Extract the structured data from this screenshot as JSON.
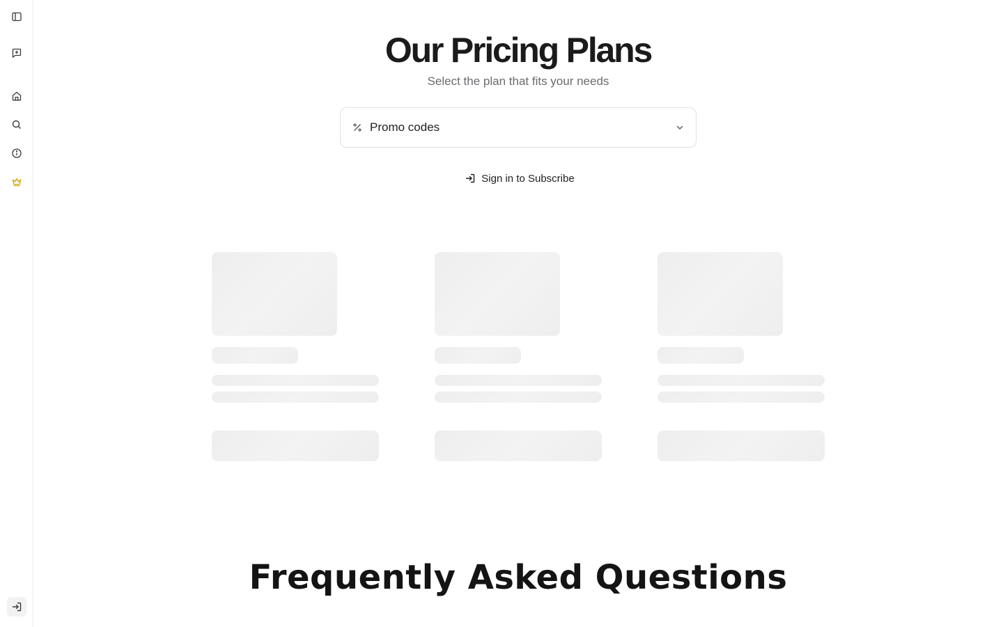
{
  "sidebar": {
    "items": [
      {
        "name": "sidebar-toggle",
        "icon": "panel-left-icon"
      },
      {
        "name": "new-chat",
        "icon": "message-plus-icon"
      },
      {
        "name": "home",
        "icon": "home-icon"
      },
      {
        "name": "search",
        "icon": "search-icon"
      },
      {
        "name": "about",
        "icon": "info-icon"
      },
      {
        "name": "pricing",
        "icon": "crown-icon",
        "color": "#d4a300"
      },
      {
        "name": "login",
        "icon": "login-icon"
      }
    ]
  },
  "header": {
    "title": "Our Pricing Plans",
    "subtitle": "Select the plan that fits your needs"
  },
  "promo": {
    "label": "Promo codes",
    "icon": "percent-icon",
    "chevron": "chevron-down-icon"
  },
  "signin": {
    "label": "Sign in to Subscribe",
    "icon": "login-icon"
  },
  "plans": {
    "state": "loading",
    "count": 3
  },
  "faq": {
    "title": "Frequently Asked Questions"
  },
  "colors": {
    "accent": "#d4a300",
    "skeleton": "#eeeeee",
    "text": "#1b1b1b",
    "muted": "#6b6b70"
  }
}
